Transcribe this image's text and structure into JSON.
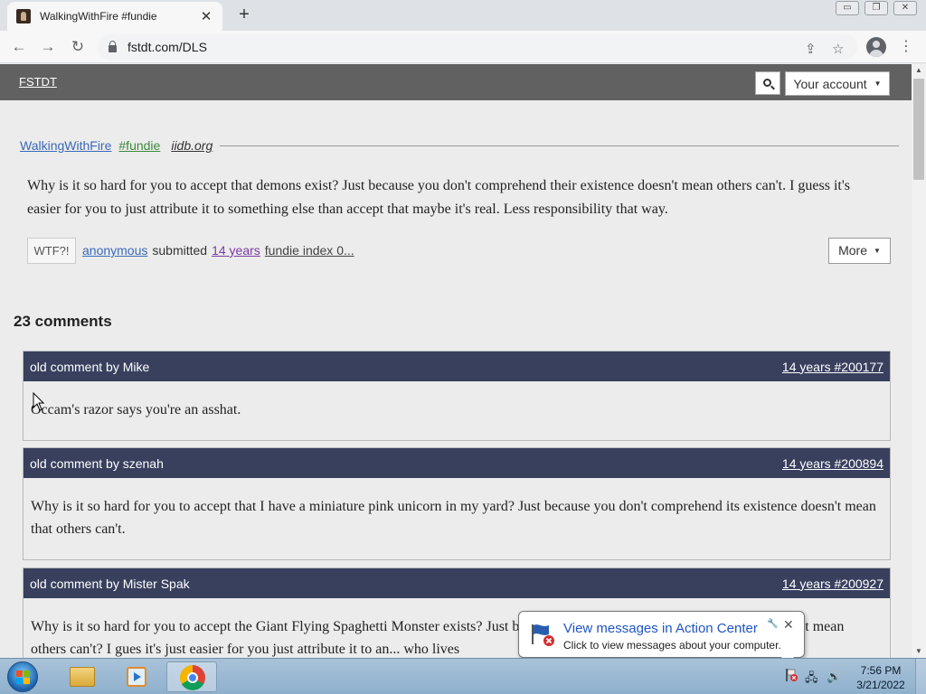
{
  "browser": {
    "tab_title": "WalkingWithFire #fundie",
    "tab_close": "✕",
    "new_tab": "+",
    "url": "fstdt.com/DLS",
    "window": {
      "minimize": "▭",
      "restore": "❐",
      "close": "✕"
    },
    "nav": {
      "back": "←",
      "forward": "→",
      "reload": "↻"
    },
    "share_icon": "⇪",
    "bookmark_icon": "☆",
    "menu_icon": "⋮"
  },
  "site": {
    "brand": "FSTDT",
    "account_label": "Your account",
    "caret": "▼"
  },
  "quote": {
    "author": "WalkingWithFire",
    "tag": "#fundie",
    "source": "iidb.org",
    "text": "Why is it so hard for you to accept that demons exist? Just because you don't comprehend their existence doesn't mean others can't. I guess it's easier for you to just attribute it to something else than accept that maybe it's real. Less responsibility that way.",
    "wtf_label": "WTF?!",
    "submitter": "anonymous",
    "submitted_label": "submitted",
    "age": "14 years",
    "fundie_index": "fundie index 0...",
    "more_label": "More"
  },
  "comments": {
    "heading": "23 comments",
    "items": [
      {
        "header": "old comment by Mike",
        "link": "14 years #200177",
        "body": "Occam's razor says you're an asshat."
      },
      {
        "header": "old comment by szenah",
        "link": "14 years #200894",
        "body": "Why is it so hard for you to accept that I have a miniature pink unicorn in my yard? Just because you don't comprehend its existence doesn't mean that others can't."
      },
      {
        "header": "old comment by Mister Spak",
        "link": "14 years #200927",
        "body": "Why is it so hard for you to accept the Giant Flying Spaghetti Monster exists? Just because you don't comprehend its existence doesn't mean others can't? I gues it's just easier for you just attribute it to an... who lives"
      }
    ]
  },
  "notification": {
    "title": "View messages in Action Center",
    "text": "Click to view messages about your computer.",
    "tools": "🔧",
    "close": "✕"
  },
  "taskbar": {
    "time": "7:56 PM",
    "date": "3/21/2022",
    "tray_network": "🖧",
    "tray_volume": "🔊"
  },
  "colors": {
    "site_header": "#616161",
    "comment_header": "#38405e",
    "author_link": "#3b69b8",
    "tag_link": "#3c8a3c",
    "age_link": "#7a3aa6"
  }
}
